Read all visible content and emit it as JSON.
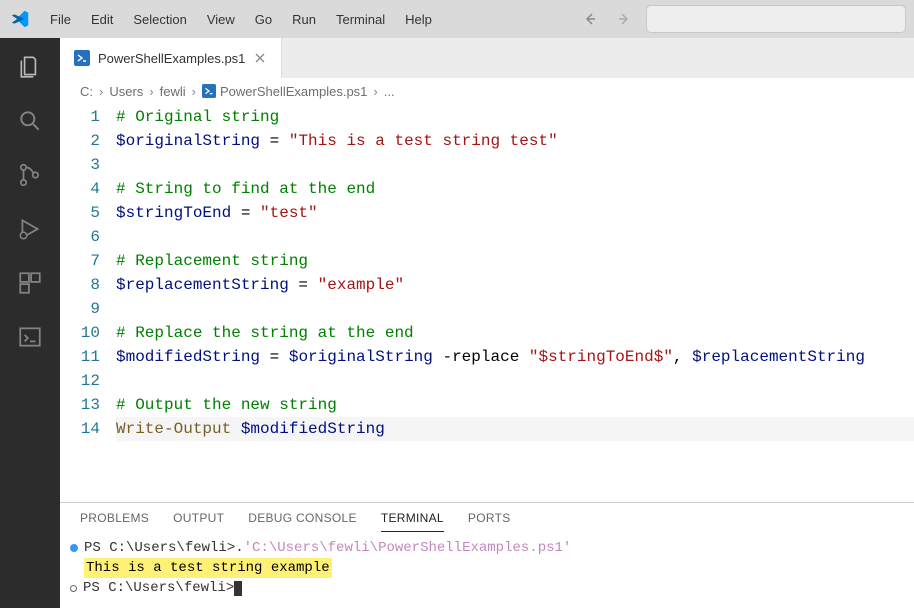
{
  "menu": [
    "File",
    "Edit",
    "Selection",
    "View",
    "Go",
    "Run",
    "Terminal",
    "Help"
  ],
  "tab": {
    "filename": "PowerShellExamples.ps1"
  },
  "breadcrumb": [
    "C:",
    "Users",
    "fewli",
    "PowerShellExamples.ps1",
    "..."
  ],
  "code": {
    "lines": [
      {
        "n": 1,
        "tokens": [
          {
            "t": "# Original string",
            "c": "tk-comment"
          }
        ]
      },
      {
        "n": 2,
        "tokens": [
          {
            "t": "$originalString",
            "c": "tk-var"
          },
          {
            "t": " = ",
            "c": "tk-op"
          },
          {
            "t": "\"This is a test string test\"",
            "c": "tk-str"
          }
        ]
      },
      {
        "n": 3,
        "tokens": []
      },
      {
        "n": 4,
        "tokens": [
          {
            "t": "# String to find at the end",
            "c": "tk-comment"
          }
        ]
      },
      {
        "n": 5,
        "tokens": [
          {
            "t": "$stringToEnd",
            "c": "tk-var"
          },
          {
            "t": " = ",
            "c": "tk-op"
          },
          {
            "t": "\"test\"",
            "c": "tk-str"
          }
        ]
      },
      {
        "n": 6,
        "tokens": []
      },
      {
        "n": 7,
        "tokens": [
          {
            "t": "# Replacement string",
            "c": "tk-comment"
          }
        ]
      },
      {
        "n": 8,
        "tokens": [
          {
            "t": "$replacementString",
            "c": "tk-var"
          },
          {
            "t": " = ",
            "c": "tk-op"
          },
          {
            "t": "\"example\"",
            "c": "tk-str"
          }
        ]
      },
      {
        "n": 9,
        "tokens": []
      },
      {
        "n": 10,
        "tokens": [
          {
            "t": "# Replace the string at the end",
            "c": "tk-comment"
          }
        ]
      },
      {
        "n": 11,
        "tokens": [
          {
            "t": "$modifiedString",
            "c": "tk-var"
          },
          {
            "t": " = ",
            "c": "tk-op"
          },
          {
            "t": "$originalString",
            "c": "tk-var"
          },
          {
            "t": " -replace ",
            "c": "tk-op"
          },
          {
            "t": "\"$stringToEnd$\"",
            "c": "tk-str"
          },
          {
            "t": ", ",
            "c": "tk-op"
          },
          {
            "t": "$replacementString",
            "c": "tk-var"
          }
        ]
      },
      {
        "n": 12,
        "tokens": []
      },
      {
        "n": 13,
        "tokens": [
          {
            "t": "# Output the new string",
            "c": "tk-comment"
          }
        ]
      },
      {
        "n": 14,
        "cursor": true,
        "tokens": [
          {
            "t": "Write-Output",
            "c": "tk-cmd"
          },
          {
            "t": " ",
            "c": "tk-op"
          },
          {
            "t": "$modifiedString",
            "c": "tk-var"
          }
        ]
      }
    ]
  },
  "panel": {
    "tabs": [
      "PROBLEMS",
      "OUTPUT",
      "DEBUG CONSOLE",
      "TERMINAL",
      "PORTS"
    ],
    "active": "TERMINAL"
  },
  "terminal": {
    "line1_prompt": "PS C:\\Users\\fewli> ",
    "line1_cmd_dot": ". ",
    "line1_path": "'C:\\Users\\fewli\\PowerShellExamples.ps1'",
    "line2_output": "This is a test string example",
    "line3_prompt": "PS C:\\Users\\fewli> "
  }
}
